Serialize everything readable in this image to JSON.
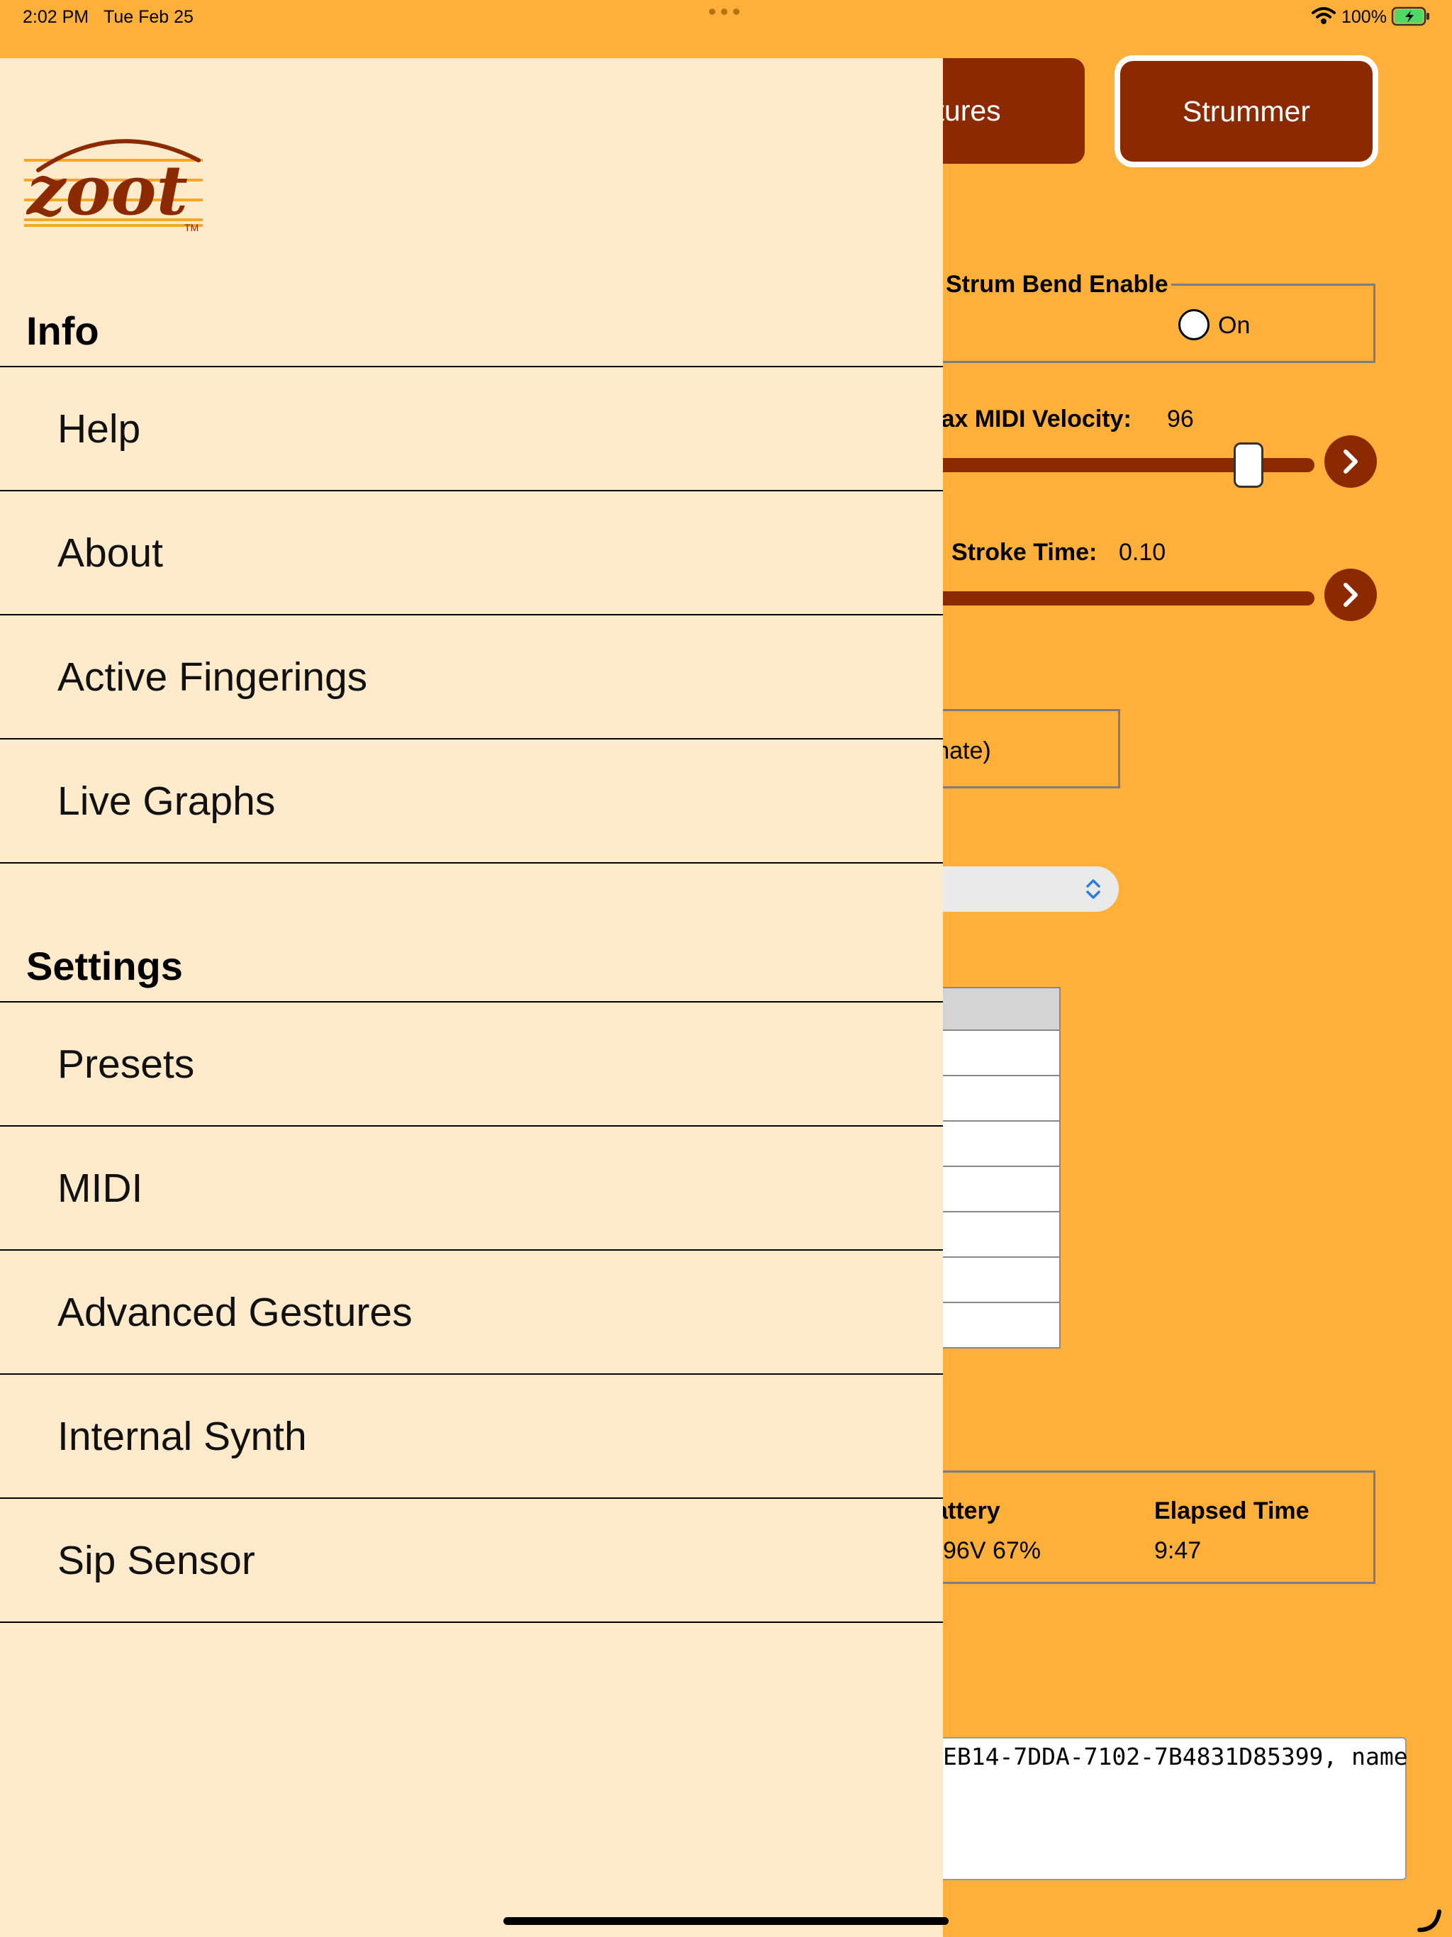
{
  "status_bar": {
    "time": "2:02 PM",
    "date": "Tue Feb 25",
    "battery_percent": "100%",
    "icons": [
      "wifi-icon",
      "battery-charging-icon"
    ]
  },
  "background_app": {
    "tabs": [
      {
        "label": "stures"
      },
      {
        "label": "Strummer"
      }
    ],
    "strum_bend": {
      "legend": "Strum Bend Enable",
      "option": "On"
    },
    "sliders": [
      {
        "label": "lax MIDI Velocity:",
        "value": "96",
        "fraction": 0.86
      },
      {
        "label": "Stroke Time:",
        "value": "0.10",
        "fraction": 1.0
      }
    ],
    "alternate_text": "ernate)",
    "table_rows": 7,
    "status_panel": {
      "headers": [
        "attery",
        "Elapsed Time"
      ],
      "values": [
        "96V 67%",
        "9:47"
      ]
    },
    "log_text": "EB14-7DDA-7102-7B4831D85399, name"
  },
  "drawer": {
    "logo_text": "zoot",
    "logo_tm": "TM",
    "info_title": "Info",
    "info_items": [
      "Help",
      "About",
      "Active Fingerings",
      "Live Graphs"
    ],
    "settings_title": "Settings",
    "settings_items": [
      "Presets",
      "MIDI",
      "Advanced Gestures",
      "Internal Synth",
      "Sip Sensor"
    ]
  },
  "colors": {
    "app_background": "#FFB03B",
    "accent": "#8B2A00",
    "drawer_background": "#FFEBCC"
  }
}
